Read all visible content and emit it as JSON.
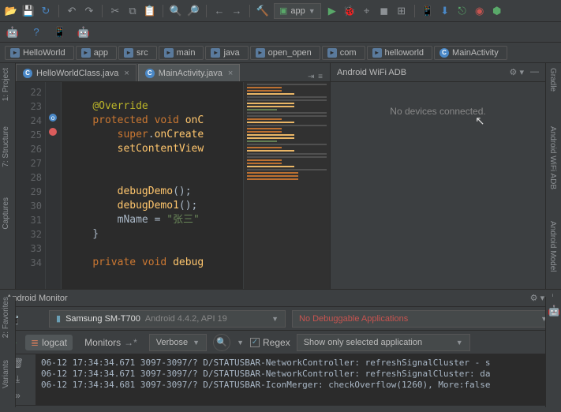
{
  "toolbar": {
    "run_config": "app"
  },
  "breadcrumb": [
    {
      "icon": "dir",
      "label": "HelloWorld"
    },
    {
      "icon": "dir",
      "label": "app"
    },
    {
      "icon": "dir",
      "label": "src"
    },
    {
      "icon": "dir",
      "label": "main"
    },
    {
      "icon": "dir",
      "label": "java"
    },
    {
      "icon": "dir",
      "label": "open_open"
    },
    {
      "icon": "dir",
      "label": "com"
    },
    {
      "icon": "dir",
      "label": "helloworld"
    },
    {
      "icon": "cls",
      "label": "MainActivity"
    }
  ],
  "tabs": [
    {
      "label": "HelloWorldClass.java",
      "active": false
    },
    {
      "label": "MainActivity.java",
      "active": true
    }
  ],
  "tab_overflow": "⇥ ≡",
  "editor": {
    "lines": [
      "22",
      "23",
      "24",
      "25",
      "26",
      "27",
      "28",
      "29",
      "30",
      "31",
      "32",
      "33",
      "34"
    ],
    "code_rows": [
      "",
      "    <span class='ann'>@Override</span>",
      "    <span class='kw'>protected void</span> <span class='mn'>onC</span>",
      "        <span class='kw'>super</span>.<span class='mn'>onCreate</span>",
      "        <span class='mn'>setContentView</span>",
      "",
      "",
      "        <span class='mn'>debugDemo</span>();",
      "        <span class='mn'>debugDemo1</span>();",
      "        mName = <span class='str'>\"张三\"</span>",
      "    }",
      "",
      "    <span class='kw'>private void</span> <span class='mn'>debug</span>"
    ]
  },
  "wifi_adb": {
    "title": "Android WiFi ADB",
    "message": "No devices connected."
  },
  "monitor": {
    "title": "Android Monitor",
    "device": "Samsung SM-T700",
    "device_info": "Android 4.4.2, API 19",
    "process": "No Debuggable Applications",
    "logcat_label": "logcat",
    "monitors_label": "Monitors",
    "verbose": "Verbose",
    "regex": "Regex",
    "filter": "Show only selected application",
    "log": [
      "06-12 17:34:34.671 3097-3097/? D/STATUSBAR-NetworkController: refreshSignalCluster - s",
      "06-12 17:34:34.671 3097-3097/? D/STATUSBAR-NetworkController: refreshSignalCluster: da",
      "06-12 17:34:34.681 3097-3097/? D/STATUSBAR-IconMerger: checkOverflow(1260), More:false"
    ]
  },
  "left_tools": [
    "1: Project",
    "7: Structure",
    "Captures",
    "2: Favorites",
    "Variants"
  ],
  "right_tools": [
    "Gradle",
    "Android WiFi ADB",
    "Android Model"
  ]
}
